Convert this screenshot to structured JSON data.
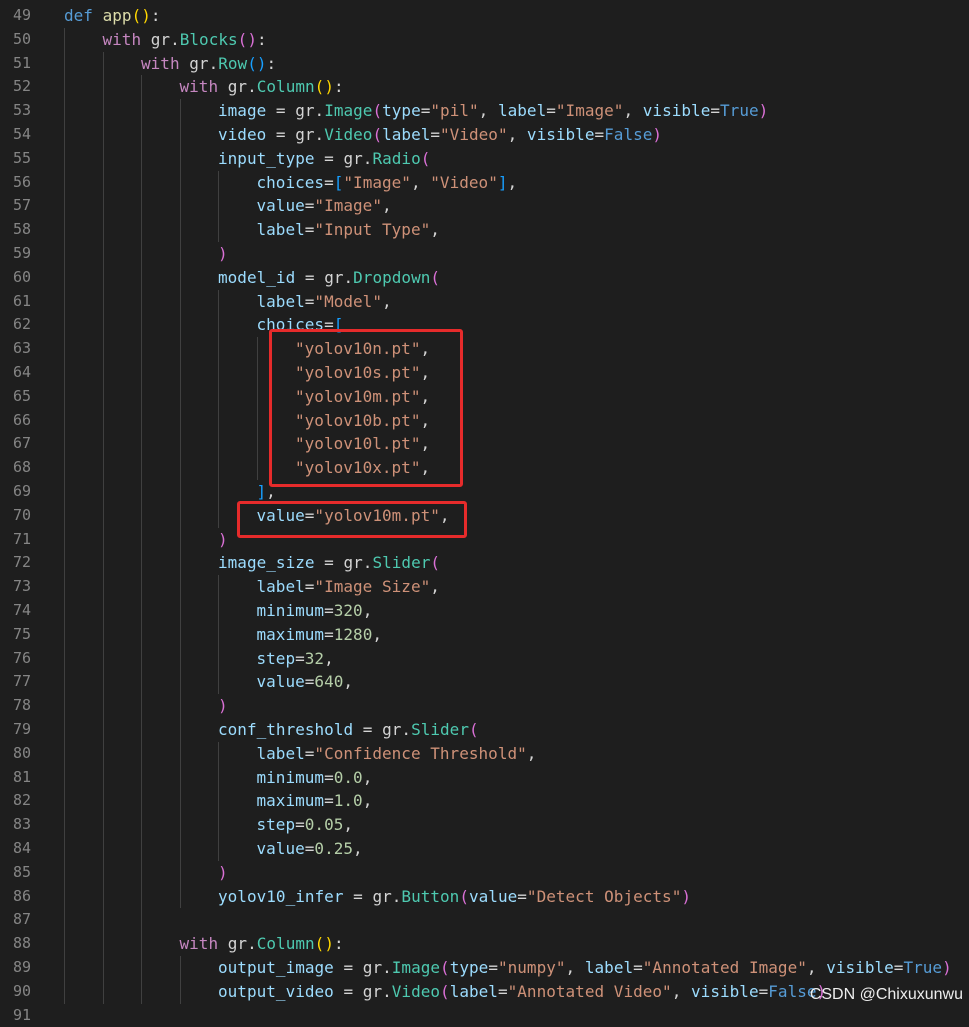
{
  "editor": {
    "theme_colors": {
      "background": "#1e1e1e",
      "line_number": "#858585",
      "keyword": "#569cd6",
      "control": "#c586c0",
      "function": "#dcdcaa",
      "identifier": "#9cdcfe",
      "class": "#4ec9b0",
      "string": "#ce9178",
      "number": "#b5cea8",
      "highlight_box": "#e62b2b"
    },
    "lines": [
      {
        "n": "49",
        "indent": 0,
        "tokens": [
          [
            "def",
            "kw"
          ],
          [
            " ",
            "op"
          ],
          [
            "app",
            "fn"
          ],
          [
            "(",
            "p1"
          ],
          [
            ")",
            "p1"
          ],
          [
            ":",
            "op"
          ]
        ]
      },
      {
        "n": "50",
        "indent": 1,
        "tokens": [
          [
            "with",
            "ctl"
          ],
          [
            " gr.",
            "op"
          ],
          [
            "Blocks",
            "cls"
          ],
          [
            "(",
            "p2"
          ],
          [
            ")",
            "p2"
          ],
          [
            ":",
            "op"
          ]
        ]
      },
      {
        "n": "51",
        "indent": 2,
        "tokens": [
          [
            "with",
            "ctl"
          ],
          [
            " gr.",
            "op"
          ],
          [
            "Row",
            "cls"
          ],
          [
            "(",
            "p3"
          ],
          [
            ")",
            "p3"
          ],
          [
            ":",
            "op"
          ]
        ]
      },
      {
        "n": "52",
        "indent": 3,
        "tokens": [
          [
            "with",
            "ctl"
          ],
          [
            " gr.",
            "op"
          ],
          [
            "Column",
            "cls"
          ],
          [
            "(",
            "p1"
          ],
          [
            ")",
            "p1"
          ],
          [
            ":",
            "op"
          ]
        ]
      },
      {
        "n": "53",
        "indent": 4,
        "tokens": [
          [
            "image",
            "id"
          ],
          [
            " = gr.",
            "op"
          ],
          [
            "Image",
            "cls"
          ],
          [
            "(",
            "p2"
          ],
          [
            "type",
            "id"
          ],
          [
            "=",
            "op"
          ],
          [
            "\"pil\"",
            "str"
          ],
          [
            ", ",
            "op"
          ],
          [
            "label",
            "id"
          ],
          [
            "=",
            "op"
          ],
          [
            "\"Image\"",
            "str"
          ],
          [
            ", ",
            "op"
          ],
          [
            "visible",
            "id"
          ],
          [
            "=",
            "op"
          ],
          [
            "True",
            "kw"
          ],
          [
            ")",
            "p2"
          ]
        ]
      },
      {
        "n": "54",
        "indent": 4,
        "tokens": [
          [
            "video",
            "id"
          ],
          [
            " = gr.",
            "op"
          ],
          [
            "Video",
            "cls"
          ],
          [
            "(",
            "p2"
          ],
          [
            "label",
            "id"
          ],
          [
            "=",
            "op"
          ],
          [
            "\"Video\"",
            "str"
          ],
          [
            ", ",
            "op"
          ],
          [
            "visible",
            "id"
          ],
          [
            "=",
            "op"
          ],
          [
            "False",
            "kw"
          ],
          [
            ")",
            "p2"
          ]
        ]
      },
      {
        "n": "55",
        "indent": 4,
        "tokens": [
          [
            "input_type",
            "id"
          ],
          [
            " = gr.",
            "op"
          ],
          [
            "Radio",
            "cls"
          ],
          [
            "(",
            "p2"
          ]
        ]
      },
      {
        "n": "56",
        "indent": 5,
        "tokens": [
          [
            "choices",
            "id"
          ],
          [
            "=",
            "op"
          ],
          [
            "[",
            "p3"
          ],
          [
            "\"Image\"",
            "str"
          ],
          [
            ", ",
            "op"
          ],
          [
            "\"Video\"",
            "str"
          ],
          [
            "]",
            "p3"
          ],
          [
            ",",
            "op"
          ]
        ]
      },
      {
        "n": "57",
        "indent": 5,
        "tokens": [
          [
            "value",
            "id"
          ],
          [
            "=",
            "op"
          ],
          [
            "\"Image\"",
            "str"
          ],
          [
            ",",
            "op"
          ]
        ]
      },
      {
        "n": "58",
        "indent": 5,
        "tokens": [
          [
            "label",
            "id"
          ],
          [
            "=",
            "op"
          ],
          [
            "\"Input Type\"",
            "str"
          ],
          [
            ",",
            "op"
          ]
        ]
      },
      {
        "n": "59",
        "indent": 4,
        "tokens": [
          [
            ")",
            "p2"
          ]
        ]
      },
      {
        "n": "60",
        "indent": 4,
        "tokens": [
          [
            "model_id",
            "id"
          ],
          [
            " = gr.",
            "op"
          ],
          [
            "Dropdown",
            "cls"
          ],
          [
            "(",
            "p2"
          ]
        ]
      },
      {
        "n": "61",
        "indent": 5,
        "tokens": [
          [
            "label",
            "id"
          ],
          [
            "=",
            "op"
          ],
          [
            "\"Model\"",
            "str"
          ],
          [
            ",",
            "op"
          ]
        ]
      },
      {
        "n": "62",
        "indent": 5,
        "tokens": [
          [
            "choices",
            "id"
          ],
          [
            "=",
            "op"
          ],
          [
            "[",
            "p3"
          ]
        ]
      },
      {
        "n": "63",
        "indent": 6,
        "tokens": [
          [
            "\"yolov10n.pt\"",
            "str"
          ],
          [
            ",",
            "op"
          ]
        ]
      },
      {
        "n": "64",
        "indent": 6,
        "tokens": [
          [
            "\"yolov10s.pt\"",
            "str"
          ],
          [
            ",",
            "op"
          ]
        ]
      },
      {
        "n": "65",
        "indent": 6,
        "tokens": [
          [
            "\"yolov10m.pt\"",
            "str"
          ],
          [
            ",",
            "op"
          ]
        ]
      },
      {
        "n": "66",
        "indent": 6,
        "tokens": [
          [
            "\"yolov10b.pt\"",
            "str"
          ],
          [
            ",",
            "op"
          ]
        ]
      },
      {
        "n": "67",
        "indent": 6,
        "tokens": [
          [
            "\"yolov10l.pt\"",
            "str"
          ],
          [
            ",",
            "op"
          ]
        ]
      },
      {
        "n": "68",
        "indent": 6,
        "tokens": [
          [
            "\"yolov10x.pt\"",
            "str"
          ],
          [
            ",",
            "op"
          ]
        ]
      },
      {
        "n": "69",
        "indent": 5,
        "tokens": [
          [
            "]",
            "p3"
          ],
          [
            ",",
            "op"
          ]
        ]
      },
      {
        "n": "70",
        "indent": 5,
        "tokens": [
          [
            "value",
            "id"
          ],
          [
            "=",
            "op"
          ],
          [
            "\"yolov10m.pt\"",
            "str"
          ],
          [
            ",",
            "op"
          ]
        ]
      },
      {
        "n": "71",
        "indent": 4,
        "tokens": [
          [
            ")",
            "p2"
          ]
        ]
      },
      {
        "n": "72",
        "indent": 4,
        "tokens": [
          [
            "image_size",
            "id"
          ],
          [
            " = gr.",
            "op"
          ],
          [
            "Slider",
            "cls"
          ],
          [
            "(",
            "p2"
          ]
        ]
      },
      {
        "n": "73",
        "indent": 5,
        "tokens": [
          [
            "label",
            "id"
          ],
          [
            "=",
            "op"
          ],
          [
            "\"Image Size\"",
            "str"
          ],
          [
            ",",
            "op"
          ]
        ]
      },
      {
        "n": "74",
        "indent": 5,
        "tokens": [
          [
            "minimum",
            "id"
          ],
          [
            "=",
            "op"
          ],
          [
            "320",
            "num"
          ],
          [
            ",",
            "op"
          ]
        ]
      },
      {
        "n": "75",
        "indent": 5,
        "tokens": [
          [
            "maximum",
            "id"
          ],
          [
            "=",
            "op"
          ],
          [
            "1280",
            "num"
          ],
          [
            ",",
            "op"
          ]
        ]
      },
      {
        "n": "76",
        "indent": 5,
        "tokens": [
          [
            "step",
            "id"
          ],
          [
            "=",
            "op"
          ],
          [
            "32",
            "num"
          ],
          [
            ",",
            "op"
          ]
        ]
      },
      {
        "n": "77",
        "indent": 5,
        "tokens": [
          [
            "value",
            "id"
          ],
          [
            "=",
            "op"
          ],
          [
            "640",
            "num"
          ],
          [
            ",",
            "op"
          ]
        ]
      },
      {
        "n": "78",
        "indent": 4,
        "tokens": [
          [
            ")",
            "p2"
          ]
        ]
      },
      {
        "n": "79",
        "indent": 4,
        "tokens": [
          [
            "conf_threshold",
            "id"
          ],
          [
            " = gr.",
            "op"
          ],
          [
            "Slider",
            "cls"
          ],
          [
            "(",
            "p2"
          ]
        ]
      },
      {
        "n": "80",
        "indent": 5,
        "tokens": [
          [
            "label",
            "id"
          ],
          [
            "=",
            "op"
          ],
          [
            "\"Confidence Threshold\"",
            "str"
          ],
          [
            ",",
            "op"
          ]
        ]
      },
      {
        "n": "81",
        "indent": 5,
        "tokens": [
          [
            "minimum",
            "id"
          ],
          [
            "=",
            "op"
          ],
          [
            "0.0",
            "num"
          ],
          [
            ",",
            "op"
          ]
        ]
      },
      {
        "n": "82",
        "indent": 5,
        "tokens": [
          [
            "maximum",
            "id"
          ],
          [
            "=",
            "op"
          ],
          [
            "1.0",
            "num"
          ],
          [
            ",",
            "op"
          ]
        ]
      },
      {
        "n": "83",
        "indent": 5,
        "tokens": [
          [
            "step",
            "id"
          ],
          [
            "=",
            "op"
          ],
          [
            "0.05",
            "num"
          ],
          [
            ",",
            "op"
          ]
        ]
      },
      {
        "n": "84",
        "indent": 5,
        "tokens": [
          [
            "value",
            "id"
          ],
          [
            "=",
            "op"
          ],
          [
            "0.25",
            "num"
          ],
          [
            ",",
            "op"
          ]
        ]
      },
      {
        "n": "85",
        "indent": 4,
        "tokens": [
          [
            ")",
            "p2"
          ]
        ]
      },
      {
        "n": "86",
        "indent": 4,
        "tokens": [
          [
            "yolov10_infer",
            "id"
          ],
          [
            " = gr.",
            "op"
          ],
          [
            "Button",
            "cls"
          ],
          [
            "(",
            "p2"
          ],
          [
            "value",
            "id"
          ],
          [
            "=",
            "op"
          ],
          [
            "\"Detect Objects\"",
            "str"
          ],
          [
            ")",
            "p2"
          ]
        ]
      },
      {
        "n": "87",
        "indent": 0,
        "tokens": []
      },
      {
        "n": "88",
        "indent": 3,
        "tokens": [
          [
            "with",
            "ctl"
          ],
          [
            " gr.",
            "op"
          ],
          [
            "Column",
            "cls"
          ],
          [
            "(",
            "p1"
          ],
          [
            ")",
            "p1"
          ],
          [
            ":",
            "op"
          ]
        ]
      },
      {
        "n": "89",
        "indent": 4,
        "tokens": [
          [
            "output_image",
            "id"
          ],
          [
            " = gr.",
            "op"
          ],
          [
            "Image",
            "cls"
          ],
          [
            "(",
            "p2"
          ],
          [
            "type",
            "id"
          ],
          [
            "=",
            "op"
          ],
          [
            "\"numpy\"",
            "str"
          ],
          [
            ", ",
            "op"
          ],
          [
            "label",
            "id"
          ],
          [
            "=",
            "op"
          ],
          [
            "\"Annotated Image\"",
            "str"
          ],
          [
            ", ",
            "op"
          ],
          [
            "visible",
            "id"
          ],
          [
            "=",
            "op"
          ],
          [
            "True",
            "kw"
          ],
          [
            ")",
            "p2"
          ]
        ]
      },
      {
        "n": "90",
        "indent": 4,
        "tokens": [
          [
            "output_video",
            "id"
          ],
          [
            " = gr.",
            "op"
          ],
          [
            "Video",
            "cls"
          ],
          [
            "(",
            "p2"
          ],
          [
            "label",
            "id"
          ],
          [
            "=",
            "op"
          ],
          [
            "\"Annotated Video\"",
            "str"
          ],
          [
            ", ",
            "op"
          ],
          [
            "visible",
            "id"
          ],
          [
            "=",
            "op"
          ],
          [
            "False",
            "kw"
          ],
          [
            ")",
            "p2"
          ]
        ]
      },
      {
        "n": "91",
        "indent": 0,
        "tokens": []
      }
    ]
  },
  "watermark": "CSDN @Chixuxunwu"
}
